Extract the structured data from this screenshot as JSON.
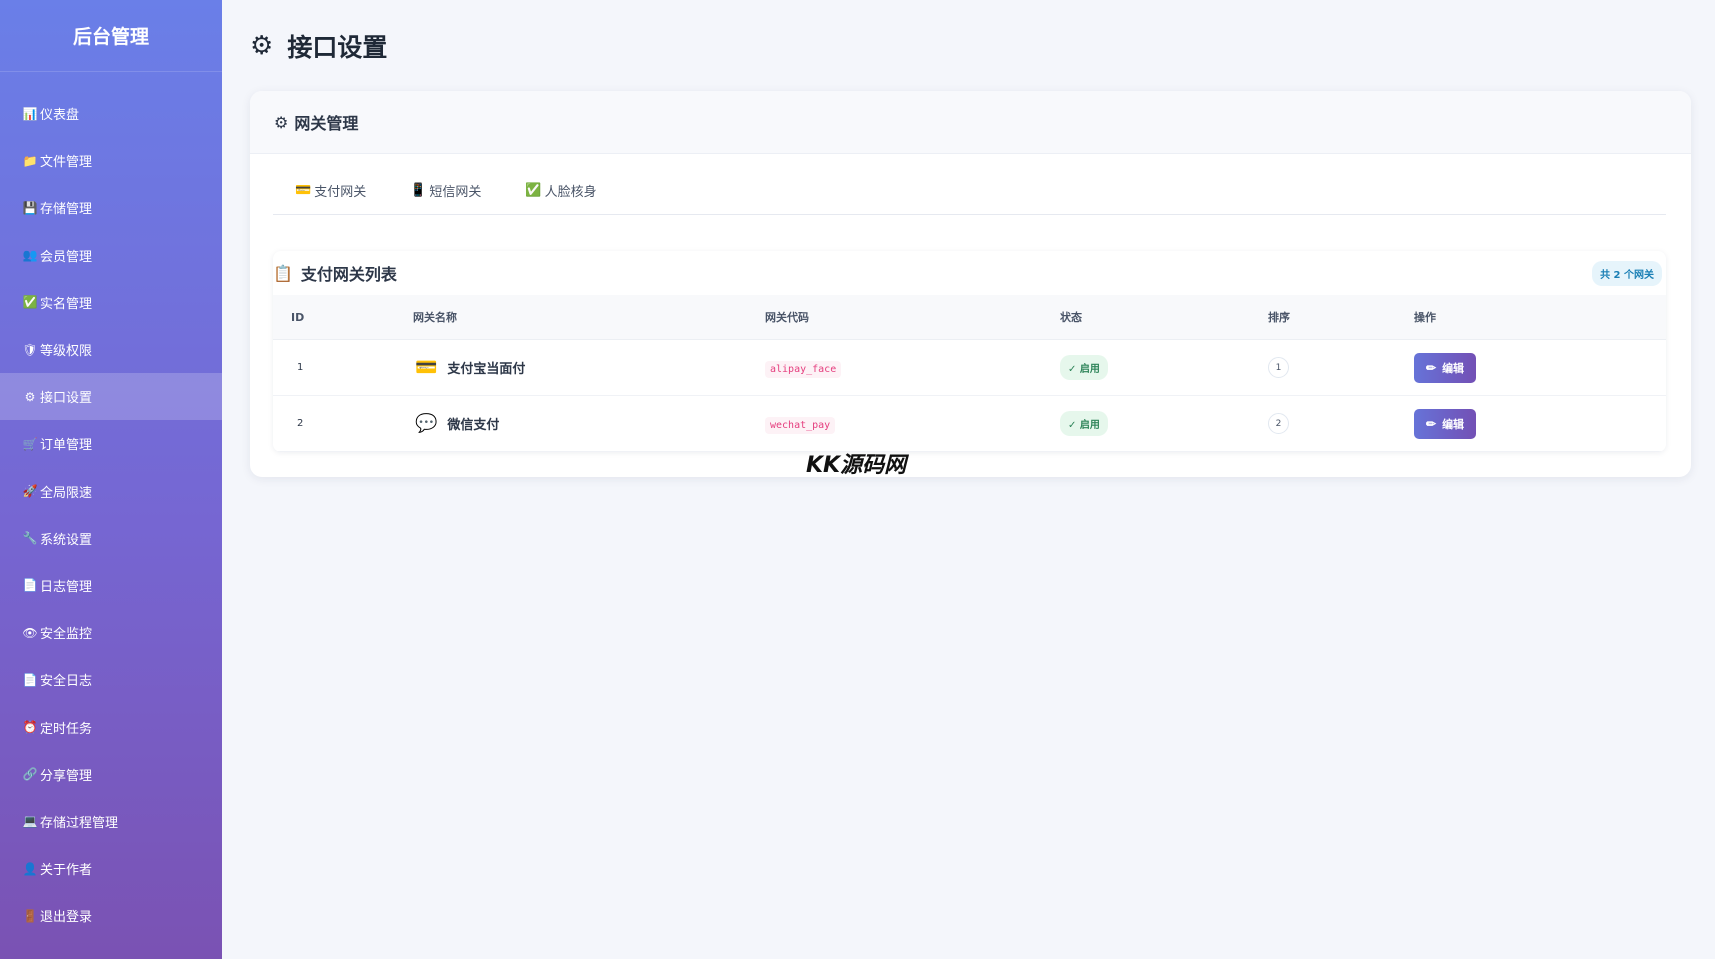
{
  "sidebar": {
    "brand": "后台管理",
    "items": [
      {
        "label": "仪表盘",
        "icon": "📊",
        "active": false
      },
      {
        "label": "文件管理",
        "icon": "📁",
        "active": false
      },
      {
        "label": "存储管理",
        "icon": "💾",
        "active": false
      },
      {
        "label": "会员管理",
        "icon": "👥",
        "active": false
      },
      {
        "label": "实名管理",
        "icon": "✅",
        "active": false
      },
      {
        "label": "等级权限",
        "icon": "🛡",
        "active": false
      },
      {
        "label": "接口设置",
        "icon": "⚙",
        "active": true
      },
      {
        "label": "订单管理",
        "icon": "🛒",
        "active": false
      },
      {
        "label": "全局限速",
        "icon": "🚀",
        "active": false
      },
      {
        "label": "系统设置",
        "icon": "🔧",
        "active": false
      },
      {
        "label": "日志管理",
        "icon": "📄",
        "active": false
      },
      {
        "label": "安全监控",
        "icon": "👁",
        "active": false
      },
      {
        "label": "安全日志",
        "icon": "📄",
        "active": false
      },
      {
        "label": "定时任务",
        "icon": "⏰",
        "active": false
      },
      {
        "label": "分享管理",
        "icon": "🔗",
        "active": false
      },
      {
        "label": "存储过程管理",
        "icon": "💻",
        "active": false
      },
      {
        "label": "关于作者",
        "icon": "👤",
        "active": false
      },
      {
        "label": "退出登录",
        "icon": "🚪",
        "active": false
      }
    ]
  },
  "header": {
    "title": "接口设置",
    "icon": "⚙"
  },
  "card": {
    "title": "网关管理",
    "icon": "⚙",
    "tabs": [
      {
        "label": "支付网关",
        "icon": "💳"
      },
      {
        "label": "短信网关",
        "icon": "📱"
      },
      {
        "label": "人脸核身",
        "icon": "✅"
      }
    ]
  },
  "panel": {
    "title": "支付网关列表",
    "icon": "📋",
    "count_badge": "共 2 个网关",
    "columns": [
      "ID",
      "网关名称",
      "网关代码",
      "状态",
      "排序",
      "操作"
    ],
    "rows": [
      {
        "id": "1",
        "icon": "💳",
        "name": "支付宝当面付",
        "code": "alipay_face",
        "status": "✓ 启用",
        "order": "1",
        "action": "编辑"
      },
      {
        "id": "2",
        "icon": "💬",
        "name": "微信支付",
        "code": "wechat_pay",
        "status": "✓ 启用",
        "order": "2",
        "action": "编辑"
      }
    ],
    "edit_icon": "✏"
  },
  "watermark": "KK源码网",
  "colors": {
    "sidebar_top": "#6a7fe8",
    "sidebar_bottom": "#7a52b3",
    "accent": "#6673d8",
    "status_green": "#2f855a",
    "code_pink": "#e53e7e"
  }
}
